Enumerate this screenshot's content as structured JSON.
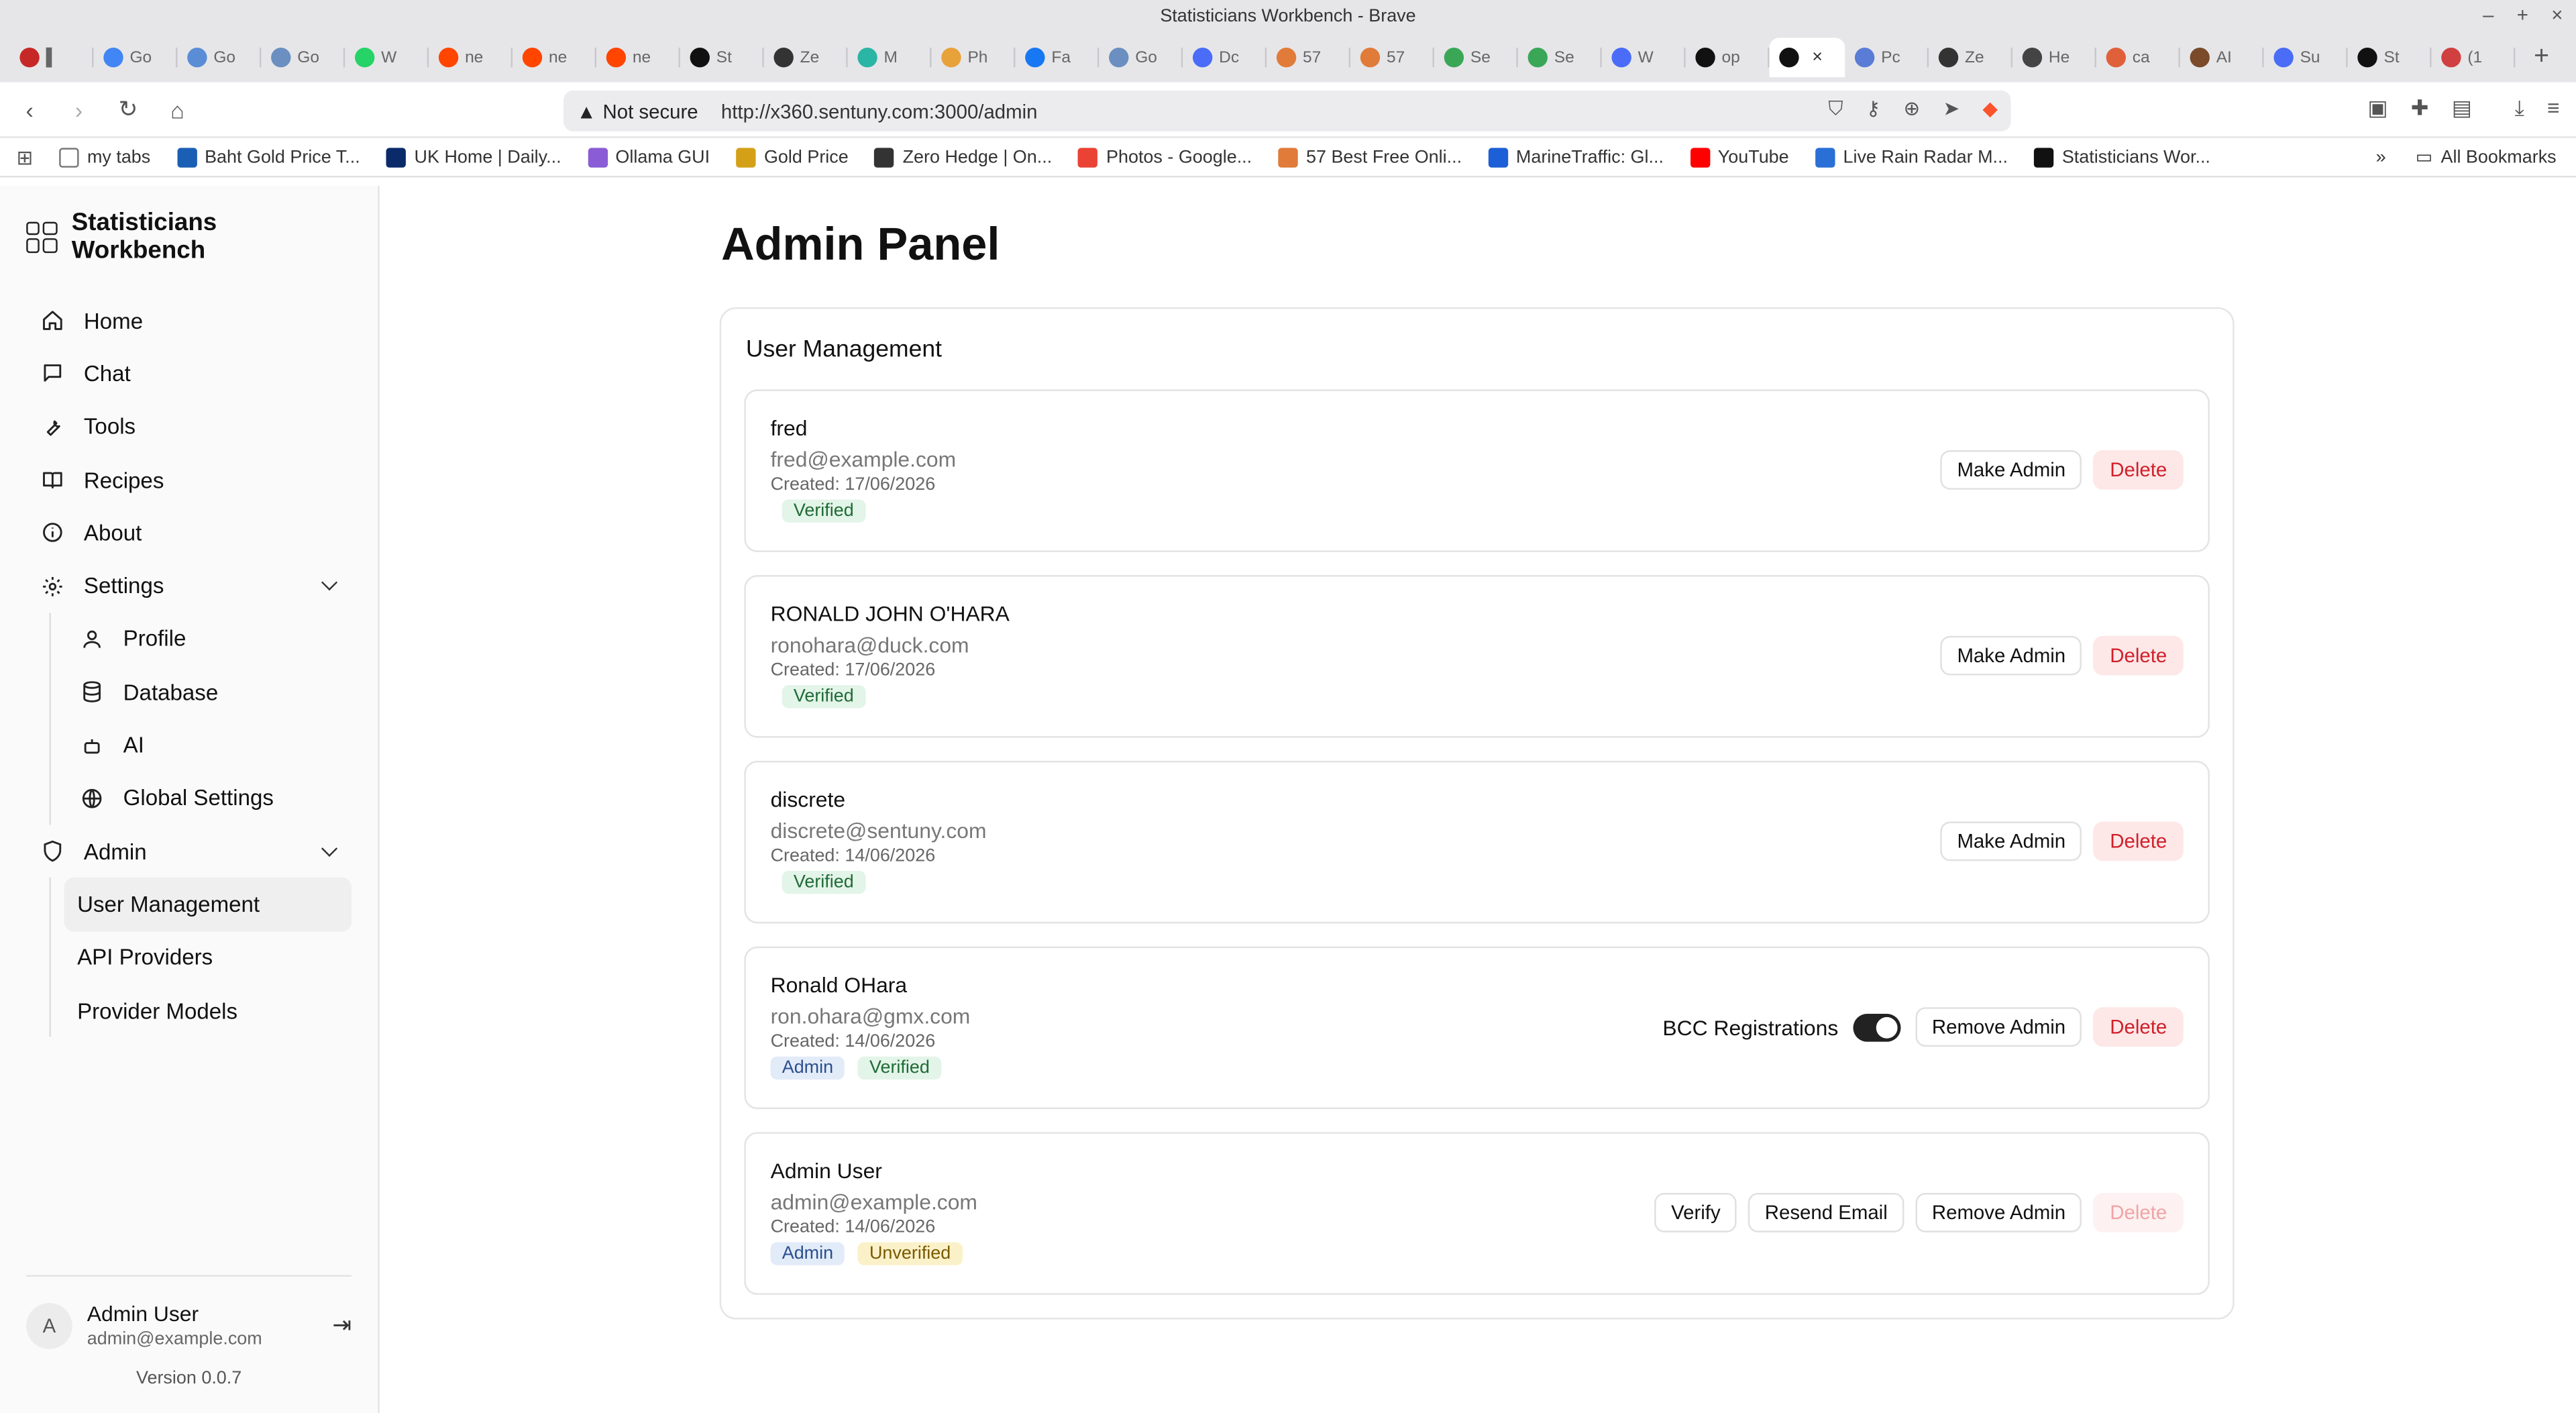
{
  "window": {
    "title": "Statisticians Workbench - Brave",
    "controls": [
      "–",
      "+",
      "×"
    ]
  },
  "tabs": [
    {
      "label": "▌",
      "color": "#c62828"
    },
    {
      "label": "Go",
      "color": "#4285f4"
    },
    {
      "label": "Go",
      "color": "#5b8dd6"
    },
    {
      "label": "Go",
      "color": "#6a8fc0"
    },
    {
      "label": "W",
      "color": "#25d366"
    },
    {
      "label": "ne",
      "color": "#ff4500"
    },
    {
      "label": "ne",
      "color": "#ff4500"
    },
    {
      "label": "ne",
      "color": "#ff4500"
    },
    {
      "label": "St",
      "color": "#111111"
    },
    {
      "label": "Ze",
      "color": "#333333"
    },
    {
      "label": "M",
      "color": "#2ab5a5"
    },
    {
      "label": "Ph",
      "color": "#e8a23a"
    },
    {
      "label": "Fa",
      "color": "#1877f2"
    },
    {
      "label": "Go",
      "color": "#6a8fc0"
    },
    {
      "label": "Dc",
      "color": "#4a6cf7"
    },
    {
      "label": "57",
      "color": "#e07b39"
    },
    {
      "label": "57",
      "color": "#e07b39"
    },
    {
      "label": "Se",
      "color": "#3aa757"
    },
    {
      "label": "Se",
      "color": "#3aa757"
    },
    {
      "label": "W",
      "color": "#4a6cf7"
    },
    {
      "label": "op",
      "color": "#111111"
    },
    {
      "label": "×",
      "color": "#111111",
      "active": true
    },
    {
      "label": "Pc",
      "color": "#5a7bd6"
    },
    {
      "label": "Ze",
      "color": "#333333"
    },
    {
      "label": "He",
      "color": "#444444"
    },
    {
      "label": "ca",
      "color": "#e0603a"
    },
    {
      "label": "AI",
      "color": "#7a4a2a"
    },
    {
      "label": "Su",
      "color": "#4a6cf7"
    },
    {
      "label": "St",
      "color": "#111111"
    },
    {
      "label": "(1",
      "color": "#d04040"
    }
  ],
  "newtab": "+",
  "address": {
    "security": "Not secure",
    "url": "http://x360.sentuny.com:3000/admin"
  },
  "bookmarks": [
    {
      "label": "my tabs",
      "color": "#777777"
    },
    {
      "label": "Baht Gold Price T...",
      "color": "#1a5fb4"
    },
    {
      "label": "UK Home | Daily...",
      "color": "#0a2a6a"
    },
    {
      "label": "Ollama GUI",
      "color": "#8a5cd6"
    },
    {
      "label": "Gold Price",
      "color": "#d4a017"
    },
    {
      "label": "Zero Hedge | On...",
      "color": "#333333"
    },
    {
      "label": "Photos - Google...",
      "color": "#ea4335"
    },
    {
      "label": "57 Best Free Onli...",
      "color": "#e07b39"
    },
    {
      "label": "MarineTraffic: Gl...",
      "color": "#1c5fd6"
    },
    {
      "label": "YouTube",
      "color": "#ff0000"
    },
    {
      "label": "Live Rain Radar M...",
      "color": "#2a6fd6"
    },
    {
      "label": "Statisticians Wor...",
      "color": "#111111"
    }
  ],
  "bookmarks_more": "»",
  "all_bookmarks": "All Bookmarks",
  "sidebar": {
    "brand": "Statisticians Workbench",
    "items": [
      {
        "label": "Home",
        "icon": "home-icon"
      },
      {
        "label": "Chat",
        "icon": "chat-icon"
      },
      {
        "label": "Tools",
        "icon": "wrench-icon"
      },
      {
        "label": "Recipes",
        "icon": "book-icon"
      },
      {
        "label": "About",
        "icon": "info-icon"
      }
    ],
    "settings": {
      "label": "Settings",
      "icon": "gear-icon"
    },
    "settings_items": [
      {
        "label": "Profile",
        "icon": "user-icon"
      },
      {
        "label": "Database",
        "icon": "database-icon"
      },
      {
        "label": "AI",
        "icon": "robot-icon"
      },
      {
        "label": "Global Settings",
        "icon": "globe-icon"
      }
    ],
    "admin": {
      "label": "Admin",
      "icon": "shield-icon"
    },
    "admin_items": [
      {
        "label": "User Management",
        "selected": true
      },
      {
        "label": "API Providers"
      },
      {
        "label": "Provider Models"
      }
    ],
    "footer": {
      "avatar": "A",
      "name": "Admin User",
      "email": "admin@example.com",
      "version": "Version 0.0.7"
    }
  },
  "page": {
    "title": "Admin Panel",
    "panel_title": "User Management"
  },
  "users": [
    {
      "name": "fred",
      "email": "fred@example.com",
      "created": "Created: 17/06/2026",
      "badges": [
        "Verified"
      ],
      "actions": [
        "Make Admin",
        "Delete"
      ]
    },
    {
      "name": "RONALD JOHN O'HARA",
      "email": "ronohara@duck.com",
      "created": "Created: 17/06/2026",
      "badges": [
        "Verified"
      ],
      "actions": [
        "Make Admin",
        "Delete"
      ]
    },
    {
      "name": "discrete",
      "email": "discrete@sentuny.com",
      "created": "Created: 14/06/2026",
      "badges": [
        "Verified"
      ],
      "actions": [
        "Make Admin",
        "Delete"
      ]
    },
    {
      "name": "Ronald OHara",
      "email": "ron.ohara@gmx.com",
      "created": "Created: 14/06/2026",
      "badges": [
        "Admin",
        "Verified"
      ],
      "bcc_label": "BCC Registrations",
      "bcc_on": true,
      "actions": [
        "Remove Admin",
        "Delete"
      ]
    },
    {
      "name": "Admin User",
      "email": "admin@example.com",
      "created": "Created: 14/06/2026",
      "badges": [
        "Admin",
        "Unverified"
      ],
      "actions": [
        "Verify",
        "Resend Email",
        "Remove Admin",
        "Delete"
      ],
      "delete_disabled": true
    }
  ],
  "colors": {
    "accent": "#111111",
    "delete": "#d0202a",
    "verified_bg": "#e3f4e8",
    "admin_bg": "#e2ebf8",
    "unverified_bg": "#fbf1c9"
  }
}
